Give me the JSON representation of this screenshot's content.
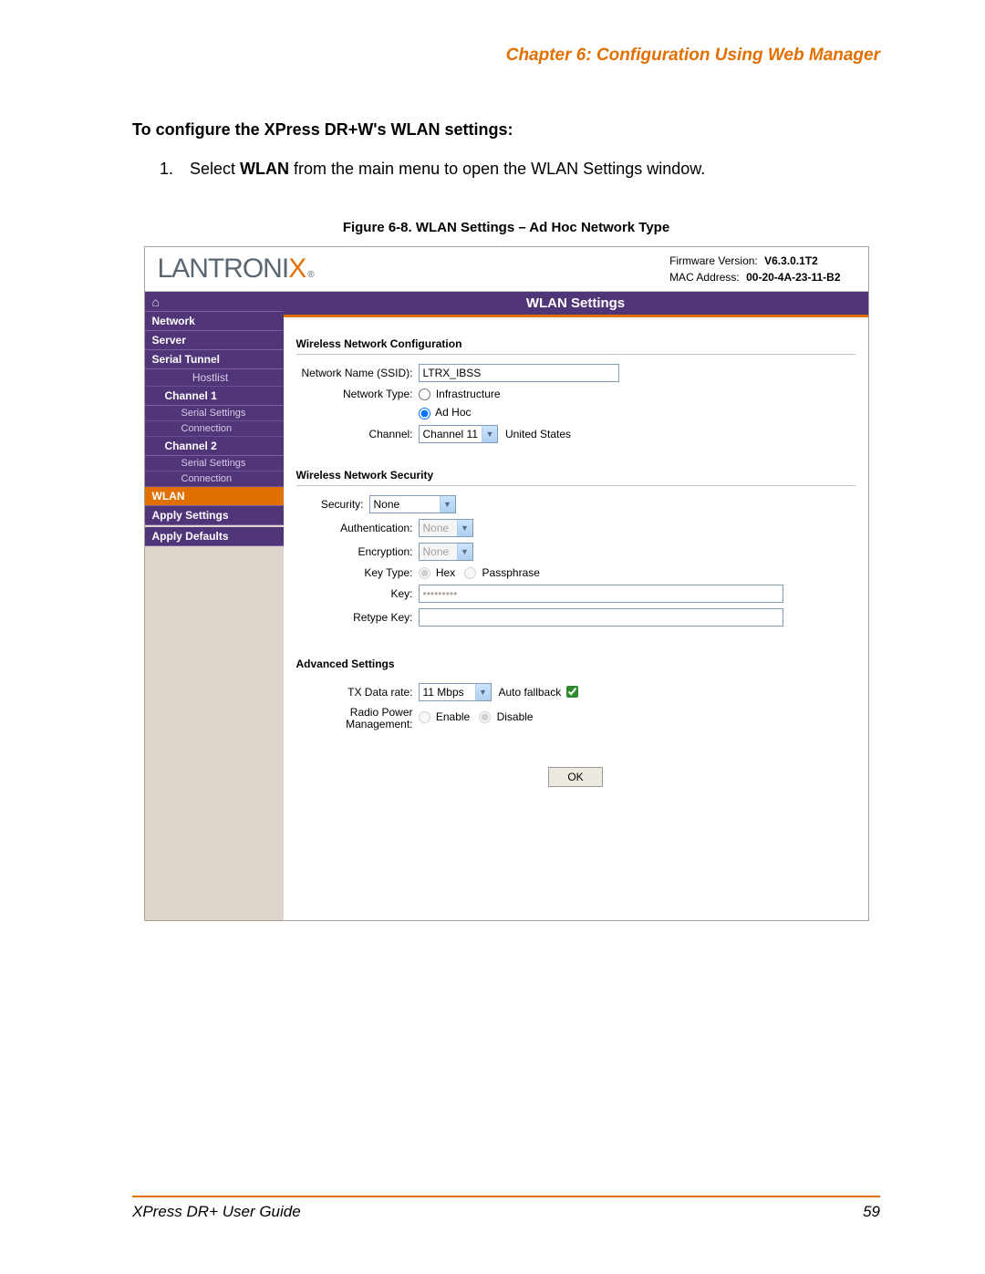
{
  "doc": {
    "chapter_header": "Chapter 6: Configuration Using Web Manager",
    "section_title": "To configure the XPress DR+W's WLAN settings:",
    "step_num": "1.",
    "step_pre": "Select ",
    "step_bold": "WLAN",
    "step_post": " from the main menu to open the WLAN Settings window.",
    "figure_caption": "Figure 6-8. WLAN Settings – Ad Hoc Network Type",
    "footer_left": "XPress DR+ User Guide",
    "footer_right": "59"
  },
  "app": {
    "logo_pre": "LANTRONI",
    "logo_x": "X",
    "logo_reg": "®",
    "fw_label": "Firmware Version:",
    "fw_value": "V6.3.0.1T2",
    "mac_label": "MAC Address:",
    "mac_value": "00-20-4A-23-11-B2",
    "panel_title": "WLAN Settings"
  },
  "nav": {
    "network": "Network",
    "server": "Server",
    "serial_tunnel": "Serial Tunnel",
    "hostlist": "Hostlist",
    "channel1": "Channel 1",
    "c1_serial": "Serial Settings",
    "c1_conn": "Connection",
    "channel2": "Channel 2",
    "c2_serial": "Serial Settings",
    "c2_conn": "Connection",
    "wlan": "WLAN",
    "apply_settings": "Apply Settings",
    "apply_defaults": "Apply Defaults"
  },
  "form": {
    "grp_netconf": "Wireless Network Configuration",
    "ssid_label": "Network Name (SSID):",
    "ssid_value": "LTRX_IBSS",
    "nettype_label": "Network Type:",
    "nettype_infra": "Infrastructure",
    "nettype_adhoc": "Ad Hoc",
    "channel_label": "Channel:",
    "channel_value": "Channel 11",
    "channel_country": "United States",
    "grp_security": "Wireless Network Security",
    "security_label": "Security:",
    "security_value": "None",
    "auth_label": "Authentication:",
    "auth_value": "None",
    "enc_label": "Encryption:",
    "enc_value": "None",
    "keytype_label": "Key Type:",
    "keytype_hex": "Hex",
    "keytype_pass": "Passphrase",
    "key_label": "Key:",
    "key_masked": "•••••••••",
    "retype_label": "Retype Key:",
    "grp_advanced": "Advanced Settings",
    "txrate_label": "TX Data rate:",
    "txrate_value": "11 Mbps",
    "autofallback_label": "Auto fallback",
    "radiopm_label": "Radio Power Management:",
    "radiopm_enable": "Enable",
    "radiopm_disable": "Disable",
    "ok_button": "OK"
  }
}
